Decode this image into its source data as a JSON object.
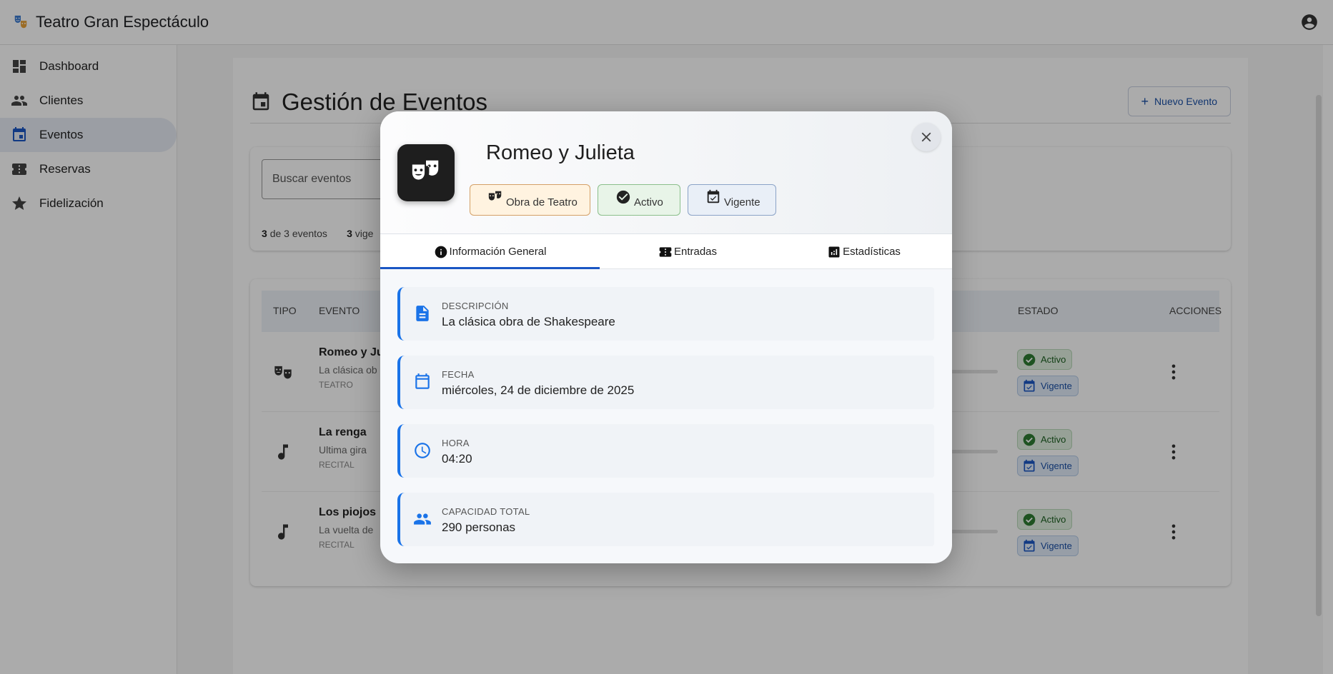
{
  "app": {
    "title": "Teatro Gran Espectáculo"
  },
  "sidebar": {
    "items": [
      {
        "label": "Dashboard"
      },
      {
        "label": "Clientes"
      },
      {
        "label": "Eventos"
      },
      {
        "label": "Reservas"
      },
      {
        "label": "Fidelización"
      }
    ],
    "active": "Eventos"
  },
  "page": {
    "title": "Gestión de Eventos",
    "new_button": "Nuevo Evento",
    "search_placeholder": "Buscar eventos",
    "counts": {
      "shown": "3",
      "shown_text": "de 3 eventos",
      "vigentes": "3",
      "vigentes_text": "vige"
    }
  },
  "table": {
    "headers": {
      "tipo": "TIPO",
      "evento": "EVENTO",
      "estado": "ESTADO",
      "acciones": "ACCIONES"
    },
    "rows": [
      {
        "name": "Romeo y Ju",
        "desc": "La clásica ob",
        "type": "TEATRO",
        "status": "Activo",
        "validity": "Vigente",
        "icon": "theater-masks-icon"
      },
      {
        "name": "La renga",
        "desc": "Ultima gira",
        "type": "RECITAL",
        "status": "Activo",
        "validity": "Vigente",
        "icon": "music-note-icon"
      },
      {
        "name": "Los piojos",
        "desc": "La vuelta de",
        "type": "RECITAL",
        "status": "Activo",
        "validity": "Vigente",
        "icon": "music-note-icon"
      }
    ]
  },
  "modal": {
    "title": "Romeo y Julieta",
    "chips": {
      "type": "Obra de Teatro",
      "status": "Activo",
      "validity": "Vigente"
    },
    "tabs": [
      "Información General",
      "Entradas",
      "Estadísticas"
    ],
    "active_tab": "Información General",
    "fields": [
      {
        "label": "DESCRIPCIÓN",
        "value": "La clásica obra de Shakespeare",
        "icon": "document-icon"
      },
      {
        "label": "FECHA",
        "value": "miércoles, 24 de diciembre de 2025",
        "icon": "calendar-icon"
      },
      {
        "label": "HORA",
        "value": "04:20",
        "icon": "clock-icon"
      },
      {
        "label": "CAPACIDAD TOTAL",
        "value": "290 personas",
        "icon": "people-icon"
      }
    ]
  },
  "colors": {
    "accent": "#1a56c4",
    "field_icon": "#1a73e8",
    "active_green": "#1b5e20"
  }
}
